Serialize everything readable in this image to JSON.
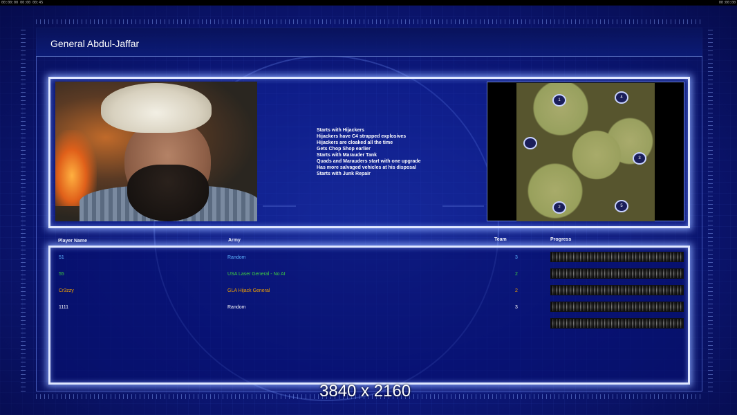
{
  "status_bar": {
    "left_text": "00:00:00 00:00 00:45",
    "right_text": "00:00:00"
  },
  "general": {
    "name": "General Abdul-Jaffar",
    "descriptions": [
      "Starts with Hijackers",
      "Hijackers have C4 strapped explosives",
      "Hijackers are cloaked all the time",
      "Gets Chop Shop earlier",
      "Starts with Marauder Tank",
      "Quads and Marauders start with one upgrade",
      "Has more salvaged vehicles at his disposal",
      "Starts with Junk Repair"
    ]
  },
  "map": {
    "spawns": [
      {
        "label": "1"
      },
      {
        "label": "4"
      },
      {
        "label": ""
      },
      {
        "label": "3"
      },
      {
        "label": "2"
      },
      {
        "label": "5"
      }
    ]
  },
  "table": {
    "headers": {
      "player": "Player Name",
      "army": "Army",
      "team": "Team",
      "progress": "Progress"
    },
    "rows": [
      {
        "player": "51",
        "army": "Random",
        "team": "3",
        "color": "#5fb4ff"
      },
      {
        "player": "55",
        "army": "USA Laser General - No AI",
        "team": "2",
        "color": "#3fd13f"
      },
      {
        "player": "Cr3zzy",
        "army": "GLA Hijack General",
        "team": "2",
        "color": "#f0a000"
      },
      {
        "player": "1111",
        "army": "Random",
        "team": "3",
        "color": "#ffffff"
      }
    ],
    "progress_bars": 5
  },
  "overlay": {
    "resolution": "3840 x 2160"
  },
  "colors": {
    "background": "#0c1678",
    "panel_border": "#dfe7ff",
    "title_text": "#ffffff"
  }
}
